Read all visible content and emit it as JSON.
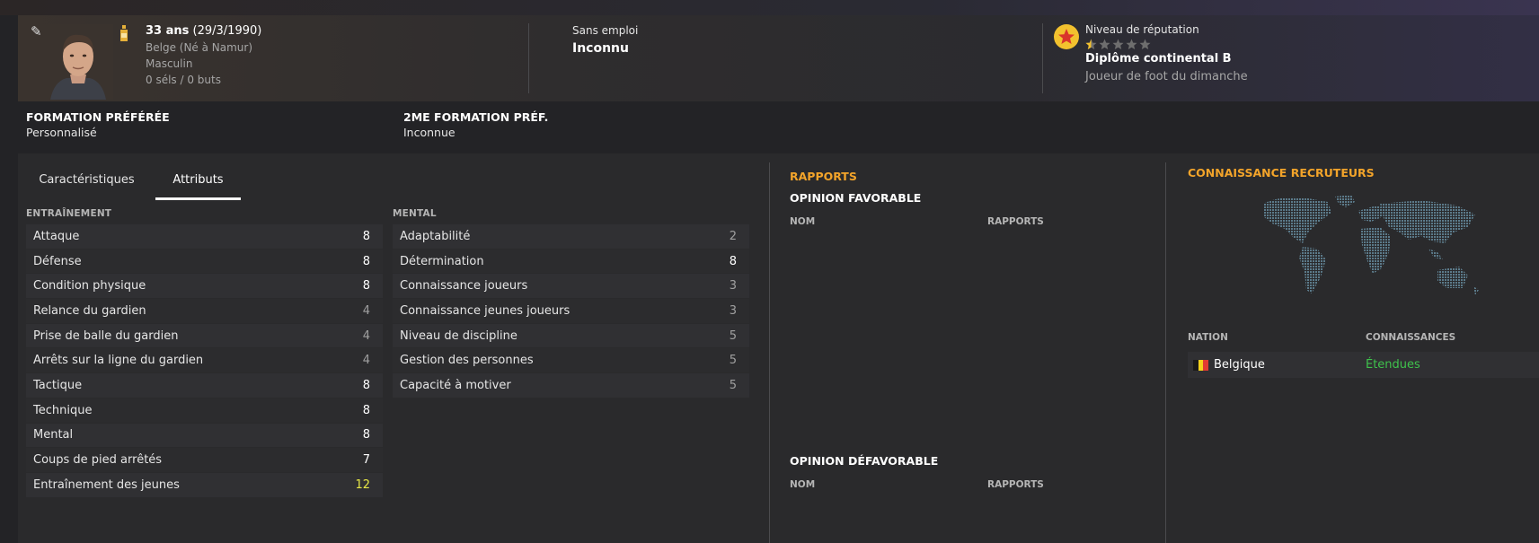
{
  "header": {
    "age": "33 ans",
    "birth": "(29/3/1990)",
    "nationality": "Belge (Né à Namur)",
    "gender": "Masculin",
    "caps": "0 séls / 0 buts",
    "status_label": "Sans emploi",
    "status_value": "Inconnu",
    "reputation_label": "Niveau de réputation",
    "reputation_stars": 0.5,
    "license": "Diplôme continental B",
    "playing_level": "Joueur de foot du dimanche"
  },
  "formations": {
    "preferred_title": "FORMATION PRÉFÉRÉE",
    "preferred_value": "Personnalisé",
    "second_title": "2ME FORMATION PRÉF.",
    "second_value": "Inconnue"
  },
  "tabs": [
    {
      "label": "Caractéristiques",
      "active": false
    },
    {
      "label": "Attributs",
      "active": true
    }
  ],
  "training": {
    "title": "ENTRAÎNEMENT",
    "rows": [
      {
        "label": "Attaque",
        "value": "8"
      },
      {
        "label": "Défense",
        "value": "8"
      },
      {
        "label": "Condition physique",
        "value": "8"
      },
      {
        "label": "Relance du gardien",
        "value": "4"
      },
      {
        "label": "Prise de balle du gardien",
        "value": "4"
      },
      {
        "label": "Arrêts sur la ligne du gardien",
        "value": "4"
      },
      {
        "label": "Tactique",
        "value": "8"
      },
      {
        "label": "Technique",
        "value": "8"
      },
      {
        "label": "Mental",
        "value": "8"
      },
      {
        "label": "Coups de pied arrêtés",
        "value": "7"
      },
      {
        "label": "Entraînement des jeunes",
        "value": "12"
      }
    ]
  },
  "mental": {
    "title": "MENTAL",
    "rows": [
      {
        "label": "Adaptabilité",
        "value": "2"
      },
      {
        "label": "Détermination",
        "value": "8"
      },
      {
        "label": "Connaissance joueurs",
        "value": "3"
      },
      {
        "label": "Connaissance jeunes joueurs",
        "value": "3"
      },
      {
        "label": "Niveau de discipline",
        "value": "5"
      },
      {
        "label": "Gestion des personnes",
        "value": "5"
      },
      {
        "label": "Capacité à motiver",
        "value": "5"
      }
    ]
  },
  "reports": {
    "title": "RAPPORTS",
    "favorable_title": "OPINION FAVORABLE",
    "unfavorable_title": "OPINION DÉFAVORABLE",
    "col_name": "NOM",
    "col_reports": "RAPPORTS"
  },
  "scouting": {
    "title": "CONNAISSANCE RECRUTEURS",
    "col_nation": "NATION",
    "col_knowledge": "CONNAISSANCES",
    "rows": [
      {
        "nation": "Belgique",
        "knowledge": "Étendues"
      }
    ]
  },
  "colors": {
    "accent_orange": "#f3a42a",
    "knowledge_green": "#3fc24c",
    "top_value_yellow": "#e8e846"
  }
}
